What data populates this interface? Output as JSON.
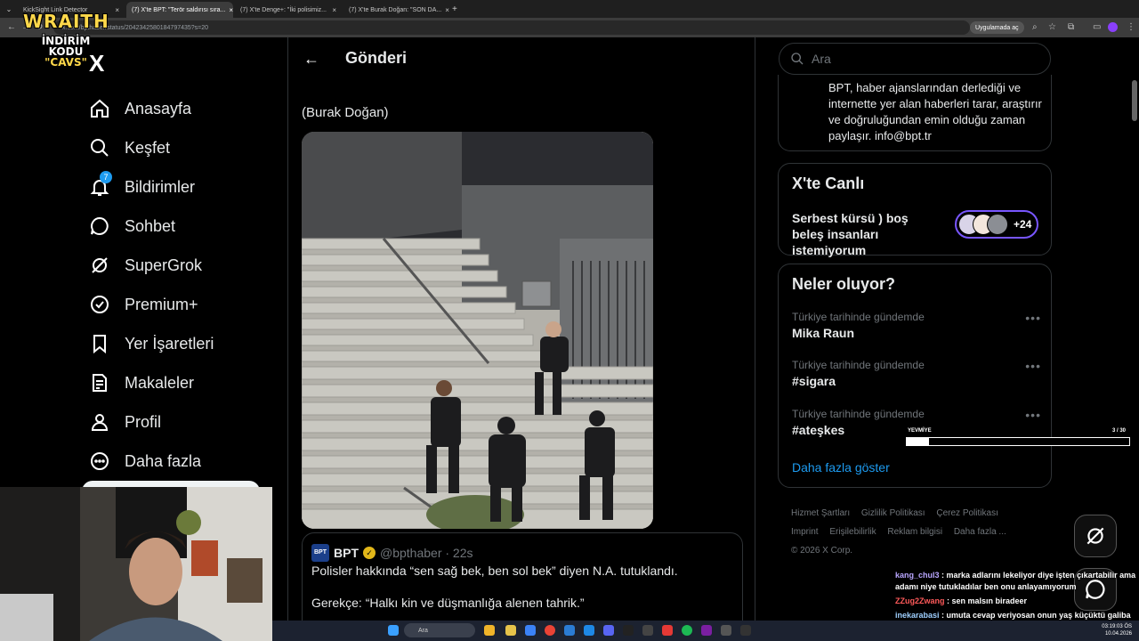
{
  "browser": {
    "tabs": [
      {
        "label": "KickSight Link Detector",
        "active": false
      },
      {
        "label": "(7) X'te BPT: \"Terör saldırısı sıra...",
        "active": true
      },
      {
        "label": "(7) X'te Denge+: \"İki polisimiz...",
        "active": false
      },
      {
        "label": "(7) X'te Burak Doğan: \"SON DA...",
        "active": false
      }
    ],
    "url": "x.com/bpthaber/status/2042342580184797435?s=20",
    "app_chip": "Uygulamada aç"
  },
  "overlay_logo": {
    "line1": "WRAITH",
    "line2": "İNDİRİM KODU",
    "line3": "\"CAVS\""
  },
  "nav": {
    "logo": "X",
    "items": [
      {
        "label": "Anasayfa",
        "icon": "home-icon"
      },
      {
        "label": "Keşfet",
        "icon": "search-icon"
      },
      {
        "label": "Bildirimler",
        "icon": "bell-icon",
        "badge": "7"
      },
      {
        "label": "Sohbet",
        "icon": "chat-icon"
      },
      {
        "label": "SuperGrok",
        "icon": "grok-icon"
      },
      {
        "label": "Premium+",
        "icon": "verified-icon"
      },
      {
        "label": "Yer İşaretleri",
        "icon": "bookmark-icon"
      },
      {
        "label": "Makaleler",
        "icon": "article-icon"
      },
      {
        "label": "Profil",
        "icon": "profile-icon"
      },
      {
        "label": "Daha fazla",
        "icon": "more-icon"
      }
    ]
  },
  "post": {
    "header_title": "Gönderi",
    "author_line": "(Burak Doğan)",
    "quote": {
      "avatar_text": "BPT",
      "name": "BPT",
      "handle": "@bpthaber · 22s",
      "text1": "Polisler hakkında “sen sağ bek, ben sol bek” diyen N.A. tutuklandı.",
      "text2": "Gerekçe: “Halkı kin ve düşmanlığa alenen tahrik.”"
    }
  },
  "right": {
    "search_placeholder": "Ara",
    "bio": "BPT, haber ajanslarından derlediği ve internette yer alan haberleri tarar, araştırır ve doğruluğundan emin olduğu zaman paylaşır. info@bpt.tr",
    "live": {
      "title": "X'te Canlı",
      "desc": "Serbest kürsü ) boş beleş insanları istemiyorum",
      "count": "+24"
    },
    "trends": {
      "title": "Neler oluyor?",
      "items": [
        {
          "context": "Türkiye tarihinde gündemde",
          "topic": "Mika Raun"
        },
        {
          "context": "Türkiye tarihinde gündemde",
          "topic": "#sigara"
        },
        {
          "context": "Türkiye tarihinde gündemde",
          "topic": "#ateşkes"
        }
      ],
      "show_more": "Daha fazla göster"
    },
    "footer": {
      "links": [
        "Hizmet Şartları",
        "Gizlilik Politikası",
        "Çerez Politikası",
        "Imprint",
        "Erişilebilirlik",
        "Reklam bilgisi",
        "Daha fazla ..."
      ],
      "copyright": "© 2026 X Corp."
    }
  },
  "progress_overlay": {
    "label": "YEVMİYE",
    "count": "3 / 30",
    "fraction": 0.1
  },
  "chat": [
    {
      "user": "kang_chul3",
      "color": "#b9a6ff",
      "text": "marka adlarını lekeliyor diye işten çıkartabilir ama adamı niye tutukladılar ben onu anlayamıyorum"
    },
    {
      "user": "ZZug2Zwang",
      "color": "#ff5a5a",
      "text": "sen malsın biradeer"
    },
    {
      "user": "inekarabasi",
      "color": "#9fd0ff",
      "text": "umuta cevap veriyosan onun yaş küçüktü galiba boşa uğraşma"
    }
  ],
  "taskbar": {
    "search": "Ara",
    "time": "03:19:03 ÖS",
    "date": "10.04.2026"
  },
  "colors": {
    "accent": "#1d9bf0",
    "background": "#000000",
    "border": "#2f3336",
    "muted": "#71767b"
  }
}
